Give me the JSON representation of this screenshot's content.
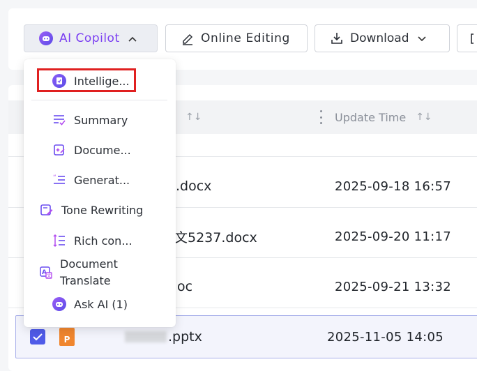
{
  "toolbar": {
    "copilot_label": "AI Copilot",
    "edit_label": "Online Editing",
    "download_label": "Download"
  },
  "table": {
    "headers": {
      "update_time": "Update Time"
    },
    "rows": [
      {
        "name": ".docx",
        "time": "2025-09-18 16:57"
      },
      {
        "name": "文5237.docx",
        "time": "2025-09-20 11:17"
      },
      {
        "name": "oc",
        "time": "2025-09-21 13:32"
      },
      {
        "name": ".pptx",
        "time": "2025-11-05 14:05",
        "selected": true,
        "file_badge": "P"
      }
    ]
  },
  "menu": {
    "items": [
      {
        "label": "Intellige...",
        "icon": "copilot-doc-icon",
        "highlighted": true
      },
      {
        "label": "Summary",
        "icon": "summary-icon"
      },
      {
        "label": "Docume...",
        "icon": "document-ai-icon"
      },
      {
        "label": "Generat...",
        "icon": "generate-icon"
      },
      {
        "label": "Tone Rewriting",
        "icon": "tone-rewrite-icon"
      },
      {
        "label": "Rich con...",
        "icon": "rich-content-icon"
      },
      {
        "label": "Document Translate",
        "icon": "translate-icon"
      },
      {
        "label": "Ask AI (1)",
        "icon": "ask-ai-icon"
      }
    ]
  },
  "colors": {
    "accent": "#7b3ff2",
    "highlight": "#e02020",
    "selected_border": "#a9b0ea",
    "checkbox": "#4f5be8"
  }
}
